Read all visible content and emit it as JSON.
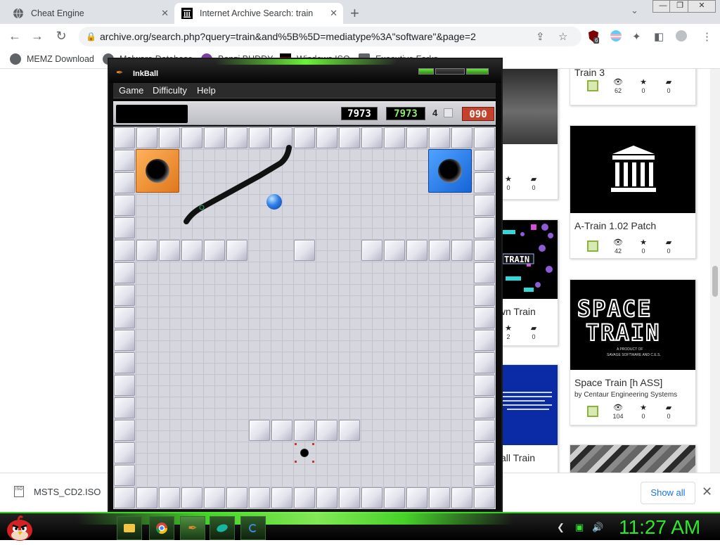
{
  "browser": {
    "tabs": [
      {
        "label": "Cheat Engine",
        "active": false
      },
      {
        "label": "Internet Archive Search: train",
        "active": true
      }
    ],
    "url": "archive.org/search.php?query=train&and%5B%5D=mediatype%3A\"software\"&page=2",
    "extension_badge": "6",
    "bookmarks": [
      {
        "label": "MEMZ Download"
      },
      {
        "label": "Malware Database"
      },
      {
        "label": "Bonzi BUDDY"
      },
      {
        "label": "Windows ISO"
      },
      {
        "label": "Executive Forks"
      }
    ]
  },
  "archive": {
    "cards": [
      {
        "title": "Train 3",
        "views": "62",
        "favs": "0",
        "comments": "0"
      },
      {
        "title": "A-Train 1.02 Patch",
        "views": "42",
        "favs": "0",
        "comments": "0"
      },
      {
        "title": "Space Train [h ASS]",
        "by": "by Centaur Engineering Systems",
        "views": "104",
        "favs": "0",
        "comments": "0"
      },
      {
        "title": "Down Train",
        "favs": "2",
        "comments": "0"
      },
      {
        "title": "a Ball Train"
      }
    ],
    "left_cards": [
      {
        "favs": "0",
        "comments": "0"
      },
      {
        "favs": "2",
        "comments": "0"
      }
    ]
  },
  "thumbnails": {
    "space_train": [
      "SPACE",
      "TRAIN",
      "A PRODUCT OF",
      "SAVAGE SOFTWARE AND C.E.S."
    ],
    "down_train": "TRAIN"
  },
  "downloads": {
    "file": "MSTS_CD2.ISO",
    "file_icon": "ISO",
    "show_all": "Show all"
  },
  "inkball": {
    "title": "InkBall",
    "menus": [
      "Game",
      "Difficulty",
      "Help"
    ],
    "score": "7973",
    "high_score": "7973",
    "balls_left": "4",
    "timer": "090",
    "colors": {
      "orange": "#ff9a2e",
      "blue": "#2f7fe8",
      "ink": "#111111"
    }
  },
  "taskbar": {
    "clock": "11:27 AM"
  },
  "icons": [
    "globe-icon",
    "archive-icon",
    "close-icon",
    "plus-icon",
    "chevron-down-icon",
    "back-icon",
    "forward-icon",
    "reload-icon",
    "lock-icon",
    "share-icon",
    "star-icon",
    "puzzle-icon",
    "sidepanel-icon",
    "profile-icon",
    "kebab-icon",
    "save-icon",
    "eye-icon",
    "fav-icon",
    "comment-icon",
    "start-orb-icon",
    "explorer-icon",
    "chrome-icon",
    "inkball-icon",
    "volume-icon"
  ]
}
